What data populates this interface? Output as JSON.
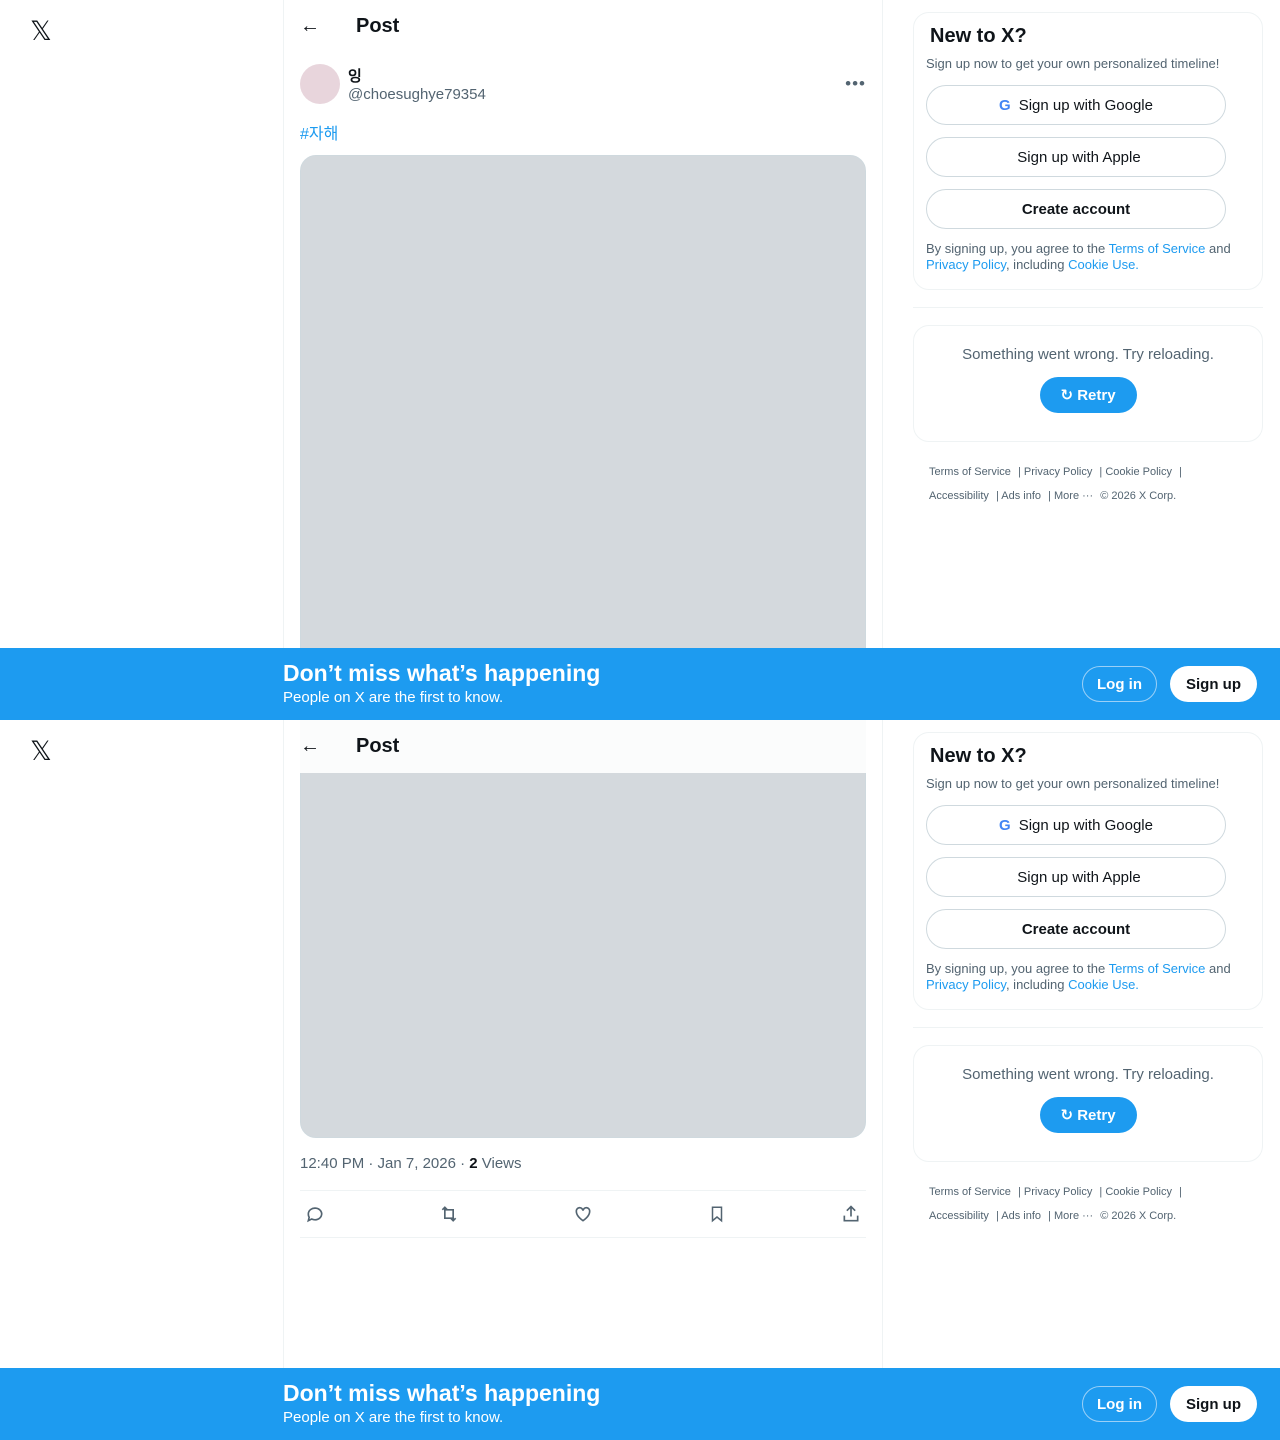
{
  "header": {
    "title": "Post"
  },
  "author": {
    "display_name": "잉",
    "handle": "@choesughye79354"
  },
  "post": {
    "hashtag": "#자해",
    "timestamp": "12:40 PM · Jan 7, 2026 · ",
    "views_count": "2",
    "views_label": " Views"
  },
  "signup_card": {
    "title": "New to X?",
    "subtitle": "Sign up now to get your own personalized timeline!",
    "google": "Sign up with Google",
    "apple": "Sign up with Apple",
    "create": "Create account",
    "legal_1": "By signing up, you agree to the ",
    "terms": "Terms of Service",
    "legal_2": " and ",
    "privacy": "Privacy Policy",
    "legal_3": ", including ",
    "cookie": "Cookie Use."
  },
  "error_card": {
    "message": "Something went wrong. Try reloading.",
    "retry": "Retry"
  },
  "footer": {
    "terms": "Terms of Service",
    "privacy": "Privacy Policy",
    "cookie": "Cookie Policy",
    "accessibility": "Accessibility",
    "ads": "Ads info",
    "more": "More ···",
    "copyright": "© 2026 X Corp."
  },
  "banner": {
    "title": "Don’t miss what’s happening",
    "subtitle": "People on X are the first to know.",
    "login": "Log in",
    "signup": "Sign up"
  }
}
